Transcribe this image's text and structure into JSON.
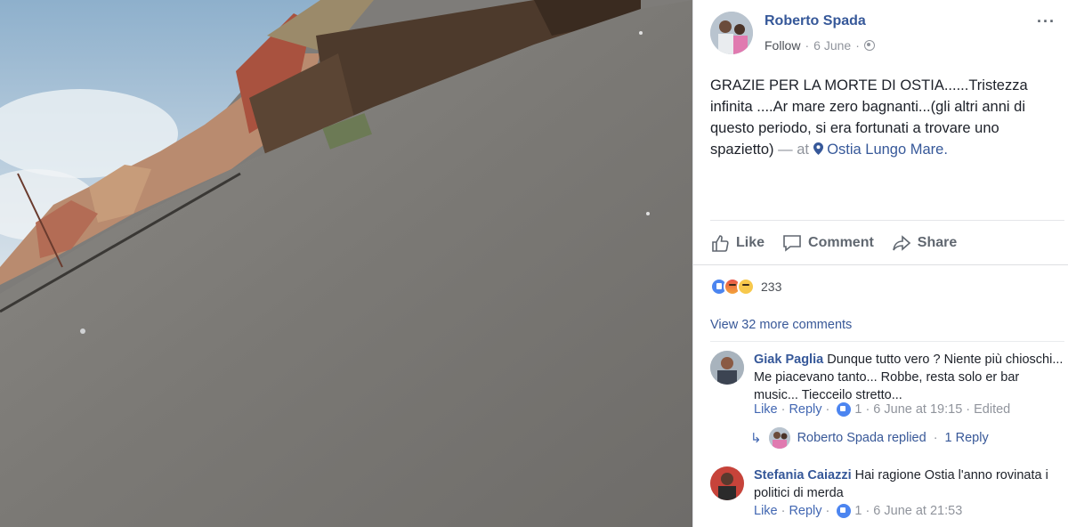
{
  "post": {
    "author": "Roberto Spada",
    "follow_label": "Follow",
    "date": "6 June",
    "privacy_icon": "globe-icon",
    "text": "GRAZIE PER LA MORTE DI OSTIA......Tristezza infinita ....Ar mare zero bagnanti...(gli altri anni di questo periodo, si era fortunati a trovare uno spazietto)",
    "at_label": "— at",
    "place": "Ostia Lungo Mare."
  },
  "actions": {
    "like": "Like",
    "comment": "Comment",
    "share": "Share"
  },
  "reactions": {
    "types": [
      "like",
      "angry",
      "sad"
    ],
    "count": "233"
  },
  "view_more": "View 32 more comments",
  "comments": [
    {
      "name": "Giak Paglia",
      "text": "Dunque tutto vero ? Niente più chioschi... Me piacevano tanto... Robbe, resta solo er bar music... Tiecceilo stretto...",
      "like": "Like",
      "reply": "Reply",
      "likes": "1",
      "time": "6 June at 19:15",
      "edited": "Edited"
    },
    {
      "name": "Stefania Caiazzi",
      "text": "Hai ragione Ostia l'anno rovinata i politici di merda",
      "like": "Like",
      "reply": "Reply",
      "likes": "1",
      "time": "6 June at 21:53"
    }
  ],
  "replied": {
    "who": "Roberto Spada replied",
    "count": "1 Reply"
  },
  "colors": {
    "link": "#365899",
    "meta": "#90949c",
    "like_blue": "#4c85f0"
  }
}
